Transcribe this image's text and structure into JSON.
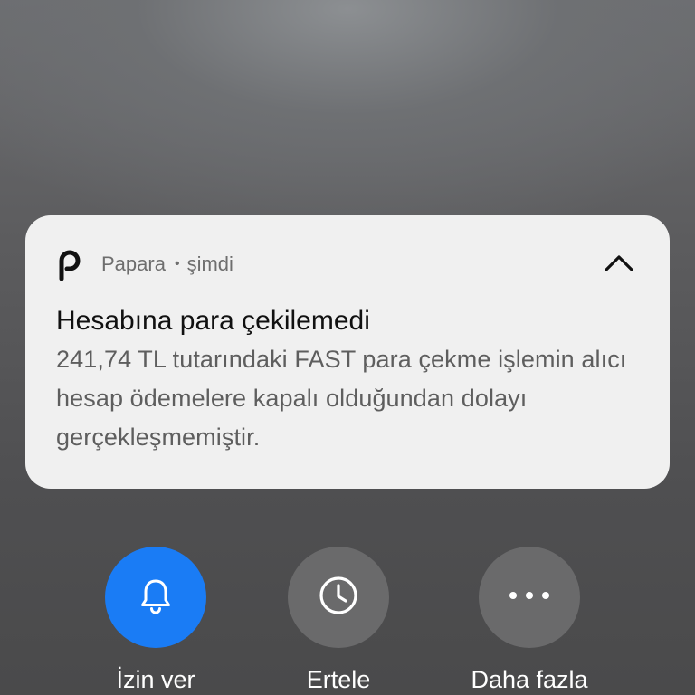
{
  "notification": {
    "app_name": "Papara",
    "separator": "•",
    "time": "şimdi",
    "title": "Hesabına para çekilemedi",
    "body": "241,74 TL tutarındaki FAST para çekme işlemin alıcı hesap ödemelere kapalı olduğundan dolayı gerçekleşmemiştir.",
    "app_icon": "papara-logo-icon",
    "collapse_icon": "chevron-up-icon"
  },
  "actions": [
    {
      "label": "İzin ver",
      "icon": "bell-icon",
      "color": "#1a7cf5"
    },
    {
      "label": "Ertele",
      "icon": "clock-icon",
      "color": "#6a6a6b"
    },
    {
      "label": "Daha fazla",
      "icon": "more-horizontal-icon",
      "color": "#6a6a6b"
    }
  ],
  "colors": {
    "card_background": "#f0f0f0",
    "primary_action": "#1a7cf5",
    "secondary_action": "#6a6a6b"
  }
}
